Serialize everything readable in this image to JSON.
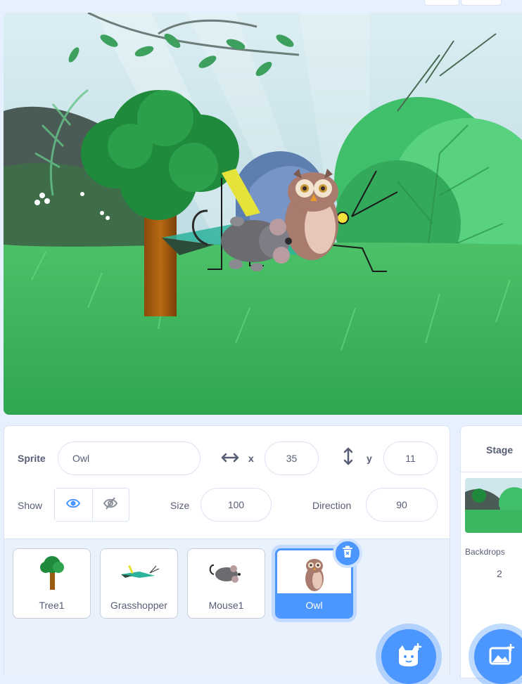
{
  "sprite_info": {
    "sprite_label": "Sprite",
    "sprite_name": "Owl",
    "x_label": "x",
    "x_value": "35",
    "y_label": "y",
    "y_value": "11",
    "show_label": "Show",
    "size_label": "Size",
    "size_value": "100",
    "direction_label": "Direction",
    "direction_value": "90"
  },
  "sprites": [
    {
      "name": "Tree1",
      "selected": false
    },
    {
      "name": "Grasshopper",
      "selected": false
    },
    {
      "name": "Mouse1",
      "selected": false
    },
    {
      "name": "Owl",
      "selected": true
    }
  ],
  "stage_panel": {
    "title": "Stage",
    "backdrops_label": "Backdrops",
    "backdrops_count": "2"
  },
  "colors": {
    "accent": "#4c97ff",
    "text": "#575e75",
    "panel_bg": "#e9f1fc"
  },
  "icons": [
    "x-arrows-icon",
    "y-arrows-icon",
    "eye-icon",
    "eye-slash-icon",
    "trash-icon",
    "add-sprite-cat-icon",
    "add-backdrop-icon"
  ]
}
